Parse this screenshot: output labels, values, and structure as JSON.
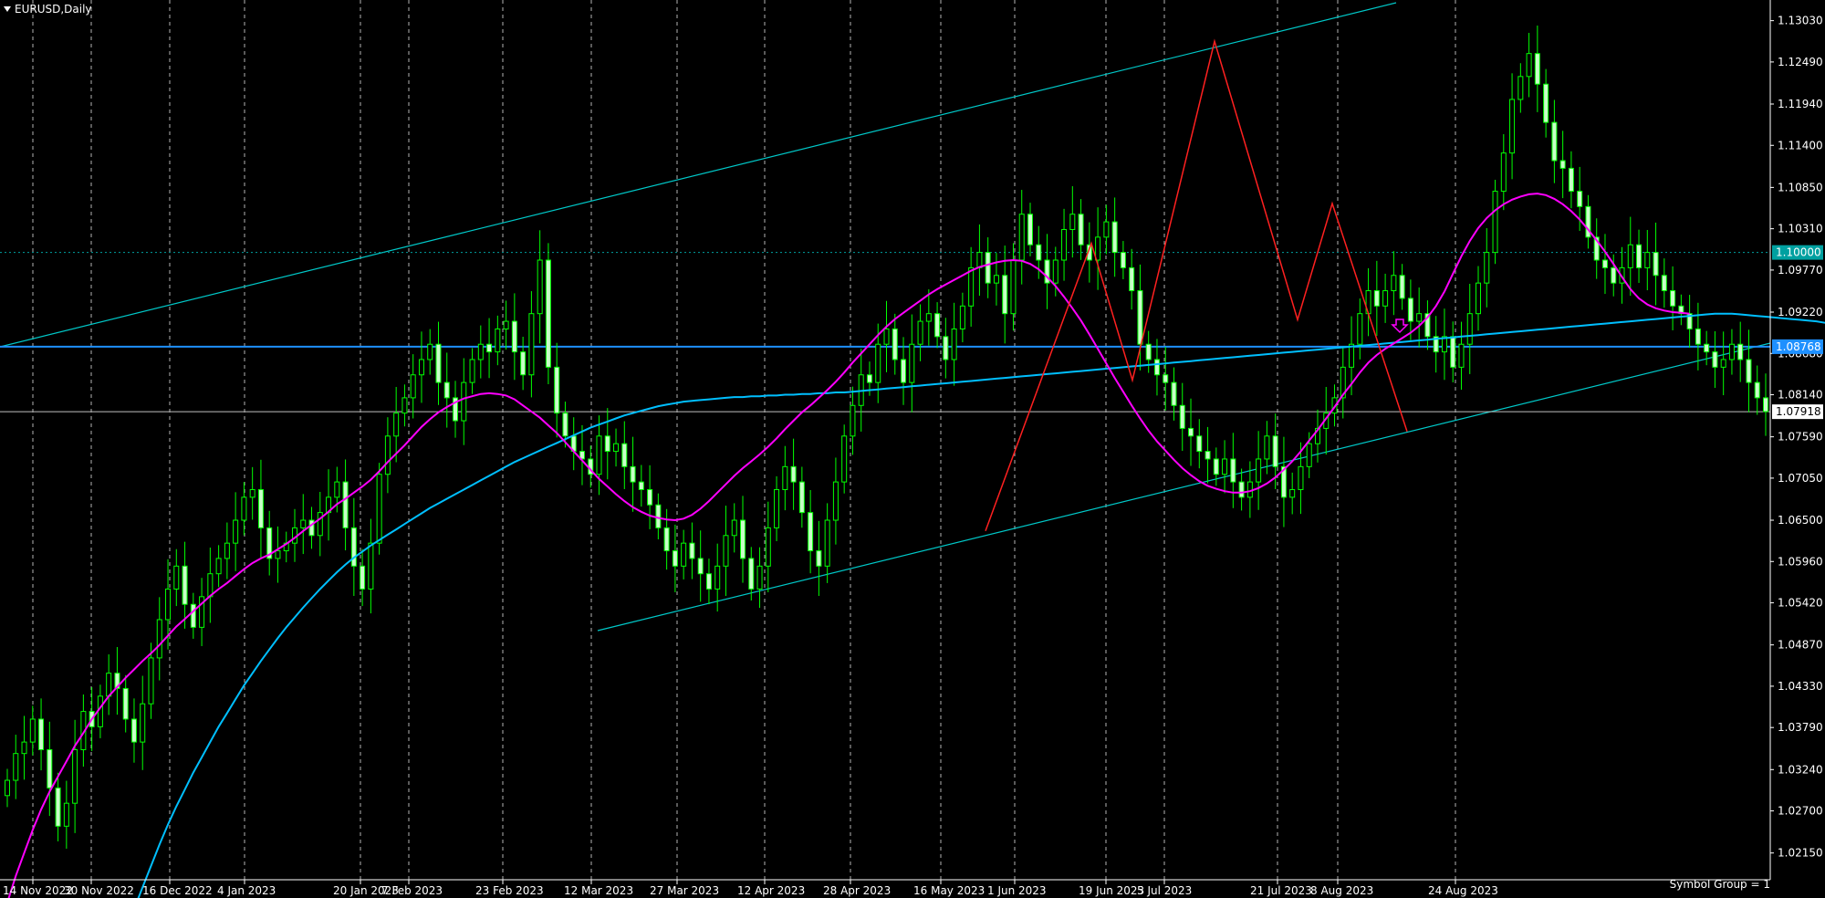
{
  "symbol_label": "EURUSD,Daily",
  "footer_label": "Symbol Group = 1",
  "colors": {
    "background": "#000000",
    "candle": "#00ff00",
    "candle_body": "#c8ffc8",
    "ma_fast": "#ff00ff",
    "ma_slow": "#00bfff",
    "channel": "#00c8c8",
    "zigzag": "#ff2020",
    "h_line_blue": "#1e90ff",
    "grid": "#ffffff"
  },
  "chart_data": {
    "type": "candlestick",
    "title": "EURUSD,Daily",
    "ylim": [
      1.018,
      1.133
    ],
    "y_ticks": [
      "1.13030",
      "1.12490",
      "1.11940",
      "1.11400",
      "1.10850",
      "1.10310",
      "1.09770",
      "1.09220",
      "1.08680",
      "1.08140",
      "1.07590",
      "1.07050",
      "1.06500",
      "1.05960",
      "1.05420",
      "1.04870",
      "1.04330",
      "1.03790",
      "1.03240",
      "1.02700",
      "1.02150"
    ],
    "x_ticks": [
      "14 Nov 2022",
      "30 Nov 2022",
      "16 Dec 2022",
      "4 Jan 2023",
      "20 Jan 2023",
      "7 Feb 2023",
      "23 Feb 2023",
      "12 Mar 2023",
      "27 Mar 2023",
      "12 Apr 2023",
      "28 Apr 2023",
      "16 May 2023",
      "1 Jun 2023",
      "19 Jun 2023",
      "5 Jul 2023",
      "21 Jul 2023",
      "8 Aug 2023",
      "24 Aug 2023"
    ],
    "price_labels": [
      {
        "value": 1.1,
        "text": "1.10000",
        "color": "#00a0a0"
      },
      {
        "value": 1.08768,
        "text": "1.08768",
        "color": "#1e90ff"
      },
      {
        "value": 1.07918,
        "text": "1.07918",
        "color": "#ffffff"
      }
    ],
    "closes": [
      1.031,
      1.0345,
      1.036,
      1.039,
      1.035,
      1.03,
      1.025,
      1.028,
      1.035,
      1.04,
      1.038,
      1.042,
      1.045,
      1.043,
      1.039,
      1.036,
      1.041,
      1.047,
      1.052,
      1.056,
      1.059,
      1.054,
      1.051,
      1.055,
      1.058,
      1.06,
      1.062,
      1.065,
      1.068,
      1.069,
      1.064,
      1.06,
      1.061,
      1.062,
      1.064,
      1.065,
      1.063,
      1.066,
      1.068,
      1.07,
      1.064,
      1.059,
      1.056,
      1.062,
      1.071,
      1.076,
      1.079,
      1.081,
      1.084,
      1.086,
      1.088,
      1.083,
      1.081,
      1.078,
      1.083,
      1.086,
      1.088,
      1.087,
      1.09,
      1.091,
      1.087,
      1.084,
      1.092,
      1.099,
      1.085,
      1.079,
      1.076,
      1.074,
      1.073,
      1.071,
      1.076,
      1.074,
      1.075,
      1.072,
      1.07,
      1.069,
      1.067,
      1.064,
      1.061,
      1.059,
      1.062,
      1.06,
      1.058,
      1.056,
      1.059,
      1.063,
      1.065,
      1.06,
      1.056,
      1.059,
      1.064,
      1.069,
      1.072,
      1.07,
      1.066,
      1.061,
      1.059,
      1.065,
      1.07,
      1.076,
      1.08,
      1.084,
      1.083,
      1.088,
      1.09,
      1.086,
      1.083,
      1.088,
      1.091,
      1.092,
      1.089,
      1.086,
      1.09,
      1.093,
      1.098,
      1.1,
      1.096,
      1.097,
      1.092,
      1.099,
      1.105,
      1.101,
      1.099,
      1.096,
      1.099,
      1.103,
      1.105,
      1.101,
      1.099,
      1.102,
      1.104,
      1.1,
      1.098,
      1.095,
      1.088,
      1.086,
      1.084,
      1.083,
      1.08,
      1.077,
      1.076,
      1.074,
      1.073,
      1.071,
      1.073,
      1.07,
      1.068,
      1.07,
      1.073,
      1.076,
      1.072,
      1.068,
      1.069,
      1.072,
      1.075,
      1.077,
      1.079,
      1.081,
      1.085,
      1.088,
      1.092,
      1.095,
      1.093,
      1.095,
      1.097,
      1.094,
      1.091,
      1.092,
      1.089,
      1.087,
      1.089,
      1.085,
      1.088,
      1.092,
      1.096,
      1.1,
      1.108,
      1.113,
      1.12,
      1.123,
      1.126,
      1.122,
      1.117,
      1.112,
      1.111,
      1.108,
      1.106,
      1.102,
      1.099,
      1.098,
      1.096,
      1.098,
      1.101,
      1.098,
      1.1,
      1.097,
      1.095,
      1.093,
      1.092,
      1.09,
      1.088,
      1.087,
      1.085,
      1.086,
      1.088,
      1.086,
      1.083,
      1.081,
      1.0792
    ],
    "ma_fast": [
      1.015,
      1.0185,
      1.0215,
      1.0245,
      1.0272,
      1.0295,
      1.0315,
      1.0335,
      1.0355,
      1.0372,
      1.039,
      1.0405,
      1.042,
      1.0432,
      1.0444,
      1.0455,
      1.0466,
      1.0476,
      1.0487,
      1.0499,
      1.0511,
      1.0521,
      1.0531,
      1.0541,
      1.0551,
      1.056,
      1.0568,
      1.0577,
      1.0586,
      1.0594,
      1.06,
      1.0605,
      1.0612,
      1.0619,
      1.0627,
      1.0636,
      1.0644,
      1.0652,
      1.0661,
      1.0671,
      1.0678,
      1.0686,
      1.0694,
      1.0703,
      1.0714,
      1.0726,
      1.0737,
      1.0748,
      1.076,
      1.0772,
      1.0782,
      1.0791,
      1.0798,
      1.0804,
      1.0809,
      1.0812,
      1.0815,
      1.0816,
      1.0815,
      1.0813,
      1.0808,
      1.08,
      1.0792,
      1.0784,
      1.0774,
      1.0764,
      1.0752,
      1.074,
      1.0728,
      1.0716,
      1.0704,
      1.0694,
      1.0684,
      1.0675,
      1.0667,
      1.0661,
      1.0656,
      1.0653,
      1.0651,
      1.065,
      1.0652,
      1.0657,
      1.0665,
      1.0675,
      1.0686,
      1.0697,
      1.0708,
      1.0718,
      1.0727,
      1.0736,
      1.0746,
      1.0757,
      1.0769,
      1.078,
      1.0791,
      1.08,
      1.081,
      1.082,
      1.0831,
      1.0843,
      1.0856,
      1.0868,
      1.088,
      1.0892,
      1.0903,
      1.0913,
      1.0921,
      1.0929,
      1.0937,
      1.0945,
      1.0952,
      1.0958,
      1.0964,
      1.097,
      1.0976,
      1.0981,
      1.0984,
      1.0987,
      1.0989,
      1.099,
      1.0989,
      1.0985,
      1.0978,
      1.0968,
      1.0956,
      1.0942,
      1.0927,
      1.0911,
      1.0893,
      1.0874,
      1.0855,
      1.0836,
      1.0818,
      1.08,
      1.0783,
      1.0767,
      1.0753,
      1.0741,
      1.0729,
      1.0718,
      1.0709,
      1.0701,
      1.0695,
      1.0691,
      1.0688,
      1.0686,
      1.0686,
      1.0688,
      1.0692,
      1.0698,
      1.0706,
      1.0716,
      1.0727,
      1.074,
      1.0754,
      1.0768,
      1.0783,
      1.0798,
      1.0814,
      1.0828,
      1.0843,
      1.0856,
      1.0866,
      1.0874,
      1.0881,
      1.0888,
      1.0895,
      1.0904,
      1.0915,
      1.093,
      1.0949,
      1.0972,
      1.0995,
      1.1015,
      1.1032,
      1.1045,
      1.1055,
      1.1063,
      1.1069,
      1.1073,
      1.1076,
      1.1077,
      1.1075,
      1.107,
      1.1063,
      1.1054,
      1.1043,
      1.103,
      1.1016,
      1.1001,
      1.0985,
      1.0968,
      1.0952,
      1.094,
      1.0932,
      1.0927,
      1.0924,
      1.0922,
      1.0921,
      1.092
    ],
    "ma_slow": [
      0.97,
      0.973,
      0.976,
      0.979,
      0.982,
      0.985,
      0.988,
      0.991,
      0.994,
      0.997,
      1.0,
      1.003,
      1.0058,
      1.0086,
      1.0114,
      1.0142,
      1.017,
      1.0198,
      1.0226,
      1.0252,
      1.0276,
      1.0298,
      1.032,
      1.034,
      1.036,
      1.038,
      1.0398,
      1.0416,
      1.0434,
      1.045,
      1.0466,
      1.0481,
      1.0496,
      1.051,
      1.0523,
      1.0536,
      1.0548,
      1.056,
      1.0571,
      1.0582,
      1.0592,
      1.0601,
      1.0609,
      1.0617,
      1.0624,
      1.0631,
      1.0638,
      1.0645,
      1.0652,
      1.0659,
      1.0666,
      1.0672,
      1.0678,
      1.0684,
      1.069,
      1.0696,
      1.0702,
      1.0708,
      1.0714,
      1.072,
      1.0726,
      1.0731,
      1.0736,
      1.0741,
      1.0746,
      1.0751,
      1.0756,
      1.0761,
      1.0766,
      1.0771,
      1.0775,
      1.0779,
      1.0783,
      1.0787,
      1.079,
      1.0793,
      1.0796,
      1.0799,
      1.0801,
      1.0803,
      1.0805,
      1.0806,
      1.0807,
      1.0808,
      1.0809,
      1.081,
      1.0811,
      1.0811,
      1.0812,
      1.0812,
      1.0813,
      1.0813,
      1.0814,
      1.0814,
      1.0815,
      1.0815,
      1.0816,
      1.0816,
      1.0817,
      1.0817,
      1.0818,
      1.0819,
      1.082,
      1.0821,
      1.0822,
      1.0823,
      1.0824,
      1.0825,
      1.0826,
      1.0827,
      1.0828,
      1.0829,
      1.083,
      1.0831,
      1.0832,
      1.0833,
      1.0834,
      1.0835,
      1.0836,
      1.0837,
      1.0838,
      1.0839,
      1.084,
      1.0841,
      1.0842,
      1.0843,
      1.0844,
      1.0845,
      1.0846,
      1.0847,
      1.0848,
      1.0849,
      1.085,
      1.0851,
      1.0852,
      1.0853,
      1.0854,
      1.0855,
      1.0856,
      1.0857,
      1.0858,
      1.0859,
      1.086,
      1.0861,
      1.0862,
      1.0863,
      1.0864,
      1.0865,
      1.0866,
      1.0867,
      1.0868,
      1.0869,
      1.087,
      1.0871,
      1.0872,
      1.0873,
      1.0874,
      1.0875,
      1.0876,
      1.0877,
      1.0878,
      1.0879,
      1.088,
      1.0881,
      1.0882,
      1.0883,
      1.0884,
      1.0885,
      1.0886,
      1.0887,
      1.0888,
      1.0889,
      1.089,
      1.0891,
      1.0892,
      1.0893,
      1.0894,
      1.0895,
      1.0896,
      1.0897,
      1.0898,
      1.0899,
      1.09,
      1.0901,
      1.0902,
      1.0903,
      1.0904,
      1.0905,
      1.0906,
      1.0907,
      1.0908,
      1.0909,
      1.091,
      1.0911,
      1.0912,
      1.0913,
      1.0914,
      1.0915,
      1.0916,
      1.0917,
      1.0918,
      1.0919,
      1.092,
      1.092,
      1.092,
      1.0919,
      1.0918,
      1.0917,
      1.0916,
      1.0915,
      1.0914,
      1.0913,
      1.0912,
      1.0911,
      1.091,
      1.0908,
      1.0906,
      1.0904,
      1.0902,
      1.09,
      1.0898,
      1.0896,
      1.0894,
      1.0892,
      1.089
    ],
    "zigzag": [
      {
        "date": "26 May 2023",
        "price": 1.0636
      },
      {
        "date": "16 Jun 2023",
        "price": 1.1012
      },
      {
        "date": "29 Jun 2023",
        "price": 1.0833
      },
      {
        "date": "18 Jul 2023",
        "price": 1.1276
      },
      {
        "date": "3 Aug 2023",
        "price": 1.0912
      },
      {
        "date": "10 Aug 2023",
        "price": 1.1064
      },
      {
        "date": "24 Aug 2023",
        "price": 1.0766
      }
    ]
  }
}
